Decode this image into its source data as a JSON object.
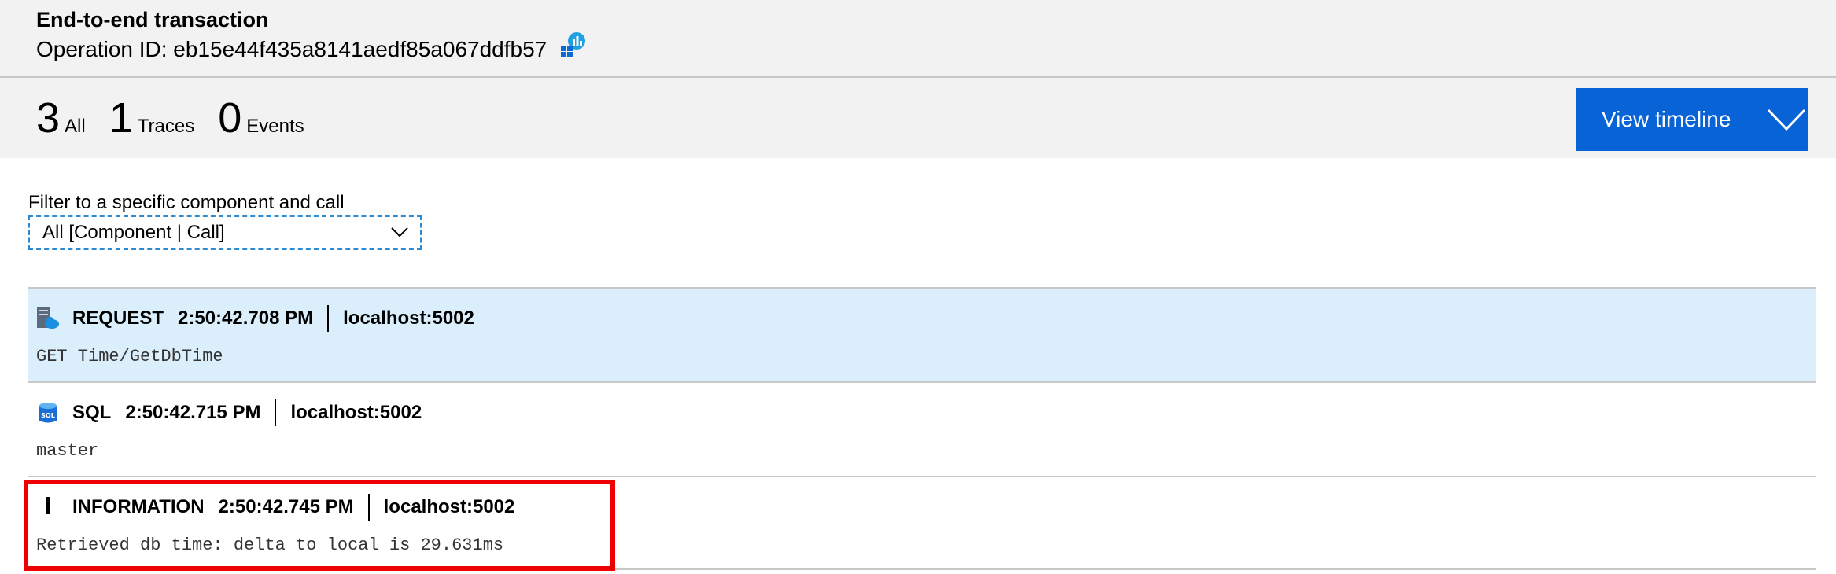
{
  "header": {
    "title": "End-to-end transaction",
    "operation_id": "Operation ID: eb15e44f435a8141aedf85a067ddfb57",
    "operation_icon": "app-insights-icon"
  },
  "summary": {
    "counts": [
      {
        "value": "3",
        "label": "All"
      },
      {
        "value": "1",
        "label": "Traces"
      },
      {
        "value": "0",
        "label": "Events"
      }
    ],
    "timeline_button": "View timeline"
  },
  "filter": {
    "label": "Filter to a specific component and call",
    "selected": "All [Component | Call]"
  },
  "rows": [
    {
      "type": "REQUEST",
      "time": "2:50:42.708 PM",
      "host": "localhost:5002",
      "detail": "GET Time/GetDbTime",
      "icon": "server-cloud-icon"
    },
    {
      "type": "SQL",
      "time": "2:50:42.715 PM",
      "host": "localhost:5002",
      "detail": "master",
      "icon": "sql-database-icon"
    },
    {
      "type": "INFORMATION",
      "time": "2:50:42.745 PM",
      "host": "localhost:5002",
      "detail": "Retrieved db time: delta to local is 29.631ms",
      "icon": "trace-bar-icon"
    }
  ],
  "colors": {
    "accent": "#0863d7",
    "selected_row": "#daeefb",
    "highlight": "#ef0000"
  }
}
